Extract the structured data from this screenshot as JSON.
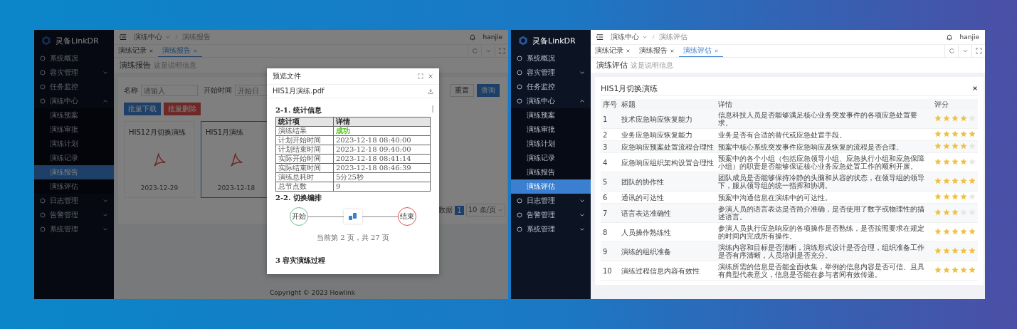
{
  "windows": [
    {
      "kind": "report",
      "logo": "灵备LinkDR",
      "sidebar": [
        {
          "label": "系统概况",
          "selected": false
        },
        {
          "label": "容灾管理",
          "selected": false,
          "expanded": false
        },
        {
          "label": "任务监控",
          "selected": false
        },
        {
          "label": "演练中心",
          "selected": false,
          "expanded": true,
          "children": [
            {
              "label": "演练预案",
              "selected": false
            },
            {
              "label": "演练审批",
              "selected": false
            },
            {
              "label": "演练计划",
              "selected": false
            },
            {
              "label": "演练记录",
              "selected": false
            },
            {
              "label": "演练报告",
              "selected": true
            },
            {
              "label": "演练评估",
              "selected": false
            }
          ]
        },
        {
          "label": "日志管理",
          "selected": false,
          "expanded": false
        },
        {
          "label": "告警管理",
          "selected": false,
          "expanded": false
        },
        {
          "label": "系统管理",
          "selected": false,
          "expanded": false
        }
      ],
      "breadcrumb": [
        "演练中心",
        "演练报告"
      ],
      "user": "hanjie",
      "tabs": [
        {
          "label": "演练记录",
          "selected": false
        },
        {
          "label": "演练报告",
          "selected": true
        }
      ],
      "page": {
        "title": "演练报告",
        "subtitle": "这是说明信息"
      },
      "filters": [
        {
          "label": "名称",
          "placeholder": "请输入"
        },
        {
          "label": "开始时间",
          "placeholder": "开始日"
        }
      ],
      "actions": [
        "重置",
        "查询"
      ],
      "batch_actions": [
        {
          "label": "批量下载",
          "kind": "primary"
        },
        {
          "label": "批量删除",
          "kind": "danger"
        }
      ],
      "reports": [
        {
          "name": "HIS12月切换演练",
          "date": "2023-12-29",
          "selected": false
        },
        {
          "name": "HIS1月演练",
          "date": "2023-12-18",
          "selected": true
        }
      ],
      "pagination": {
        "total_text": "数据",
        "page": "1",
        "page_size": "10 条/页"
      },
      "footer": "Copyright © 2023 Howlink",
      "modal": {
        "title": "预览文件",
        "file": "HIS1月演练.pdf",
        "pdf": {
          "heading_1": "2-1. 统计信息",
          "columns": [
            "统计项",
            "详情"
          ],
          "rows": [
            {
              "item": "演练结果",
              "value": "成功",
              "color": "#52c41a"
            },
            {
              "item": "计划开始时间",
              "value": "2023-12-18 08:40:00"
            },
            {
              "item": "计划结束时间",
              "value": "2023-12-18 09:40:00"
            },
            {
              "item": "实际开始时间",
              "value": "2023-12-18 08:41:14"
            },
            {
              "item": "实际结束时间",
              "value": "2023-12-18 08:46:39"
            },
            {
              "item": "演练总耗时",
              "value": "5分25秒"
            },
            {
              "item": "总节点数",
              "value": "9"
            }
          ],
          "heading_2": "2-2. 切换编排",
          "flow": [
            {
              "kind": "start",
              "label": "开始"
            },
            {
              "kind": "node"
            },
            {
              "kind": "end",
              "label": "结束"
            }
          ],
          "page_note": "当前第 2 页，共 27 页",
          "heading_3": "3 容灾演练过程"
        }
      }
    },
    {
      "kind": "evaluation",
      "logo": "灵备LinkDR",
      "sidebar": [
        {
          "label": "系统概况",
          "selected": false
        },
        {
          "label": "容灾管理",
          "selected": false,
          "expanded": false
        },
        {
          "label": "任务监控",
          "selected": false
        },
        {
          "label": "演练中心",
          "selected": false,
          "expanded": true,
          "children": [
            {
              "label": "演练预案",
              "selected": false
            },
            {
              "label": "演练审批",
              "selected": false
            },
            {
              "label": "演练计划",
              "selected": false
            },
            {
              "label": "演练记录",
              "selected": false
            },
            {
              "label": "演练报告",
              "selected": false
            },
            {
              "label": "演练评估",
              "selected": true
            }
          ]
        },
        {
          "label": "日志管理",
          "selected": false,
          "expanded": false
        },
        {
          "label": "告警管理",
          "selected": false,
          "expanded": false
        },
        {
          "label": "系统管理",
          "selected": false,
          "expanded": false
        }
      ],
      "breadcrumb": [
        "演练中心",
        "演练评估"
      ],
      "user": "hanjie",
      "tabs": [
        {
          "label": "演练记录",
          "selected": false
        },
        {
          "label": "演练报告",
          "selected": false
        },
        {
          "label": "演练评估",
          "selected": true
        }
      ],
      "page": {
        "title": "演练评估",
        "subtitle": "这是说明信息"
      },
      "evaluation": {
        "title": "HIS1月切换演练",
        "columns": [
          "序号",
          "标题",
          "详情",
          "评分"
        ],
        "rows": [
          {
            "no": "1",
            "title": "技术应急响应恢复能力",
            "detail": "信息科技人员是否能够满足核心业务突发事件的各项应急处置要求。",
            "stars": 4
          },
          {
            "no": "2",
            "title": "业务应急响应恢复能力",
            "detail": "业务是否有合适的替代或应急处置手段。",
            "stars": 5
          },
          {
            "no": "3",
            "title": "应急响应预案处置流程合理性",
            "detail": "预案中核心系统突发事件应急响应及恢复的流程是否合理。",
            "stars": 4
          },
          {
            "no": "4",
            "title": "应急响应组织架构设置合理性",
            "detail": "预案中的各个小组（包括应急领导小组、应急执行小组和应急保障小组）的职责是否能够保证核心业务应急处置工作的顺利开展。",
            "stars": 4
          },
          {
            "no": "5",
            "title": "团队的协作性",
            "detail": "团队成员是否能够保持冷静的头脑和从容的状态，在领导组的领导下，服从领导组的统一指挥和协调。",
            "stars": 5
          },
          {
            "no": "6",
            "title": "通讯的可达性",
            "detail": "预案中沟通信息在演练中的可达性。",
            "stars": 4
          },
          {
            "no": "7",
            "title": "语言表达准确性",
            "detail": "参演人员的语言表达是否简介准确，是否使用了数字或物理性的描述语言。",
            "stars": 3
          },
          {
            "no": "8",
            "title": "人员操作熟练性",
            "detail": "参演人员执行应急响应的各项操作是否熟练，是否按照要求在规定的时间内完成所有操作。",
            "stars": 5
          },
          {
            "no": "9",
            "title": "演练的组织准备",
            "detail": "演练内容和目标是否清晰，演练形式设计是否合理，组织准备工作是否有序清晰，人员培训是否充分。",
            "stars": 5
          },
          {
            "no": "10",
            "title": "演练过程信息内容有效性",
            "detail": "演练所需的信息是否能全面收集，举例的信息内容是否可信、且具有典型代表意义，信息是否能在参与者间有效传递。",
            "stars": 5
          }
        ]
      }
    }
  ]
}
